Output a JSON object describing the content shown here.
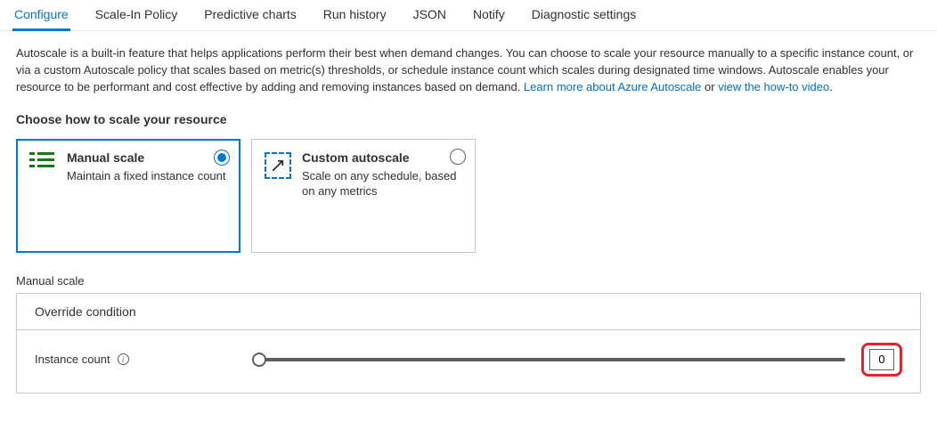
{
  "tabs": {
    "configure": "Configure",
    "scaleIn": "Scale-In Policy",
    "predictive": "Predictive charts",
    "runHistory": "Run history",
    "json": "JSON",
    "notify": "Notify",
    "diagnostic": "Diagnostic settings"
  },
  "description": {
    "text1": "Autoscale is a built-in feature that helps applications perform their best when demand changes. You can choose to scale your resource manually to a specific instance count, or via a custom Autoscale policy that scales based on metric(s) thresholds, or schedule instance count which scales during designated time windows. Autoscale enables your resource to be performant and cost effective by adding and removing instances based on demand. ",
    "link1": "Learn more about Azure Autoscale",
    "sep": " or ",
    "link2": "view the how-to video",
    "tail": "."
  },
  "sectionTitle": "Choose how to scale your resource",
  "options": {
    "manual": {
      "title": "Manual scale",
      "sub": "Maintain a fixed instance count"
    },
    "custom": {
      "title": "Custom autoscale",
      "sub": "Scale on any schedule, based on any metrics"
    }
  },
  "panel": {
    "groupLabel": "Manual scale",
    "header": "Override condition",
    "instanceLabel": "Instance count",
    "instanceValue": "0"
  }
}
